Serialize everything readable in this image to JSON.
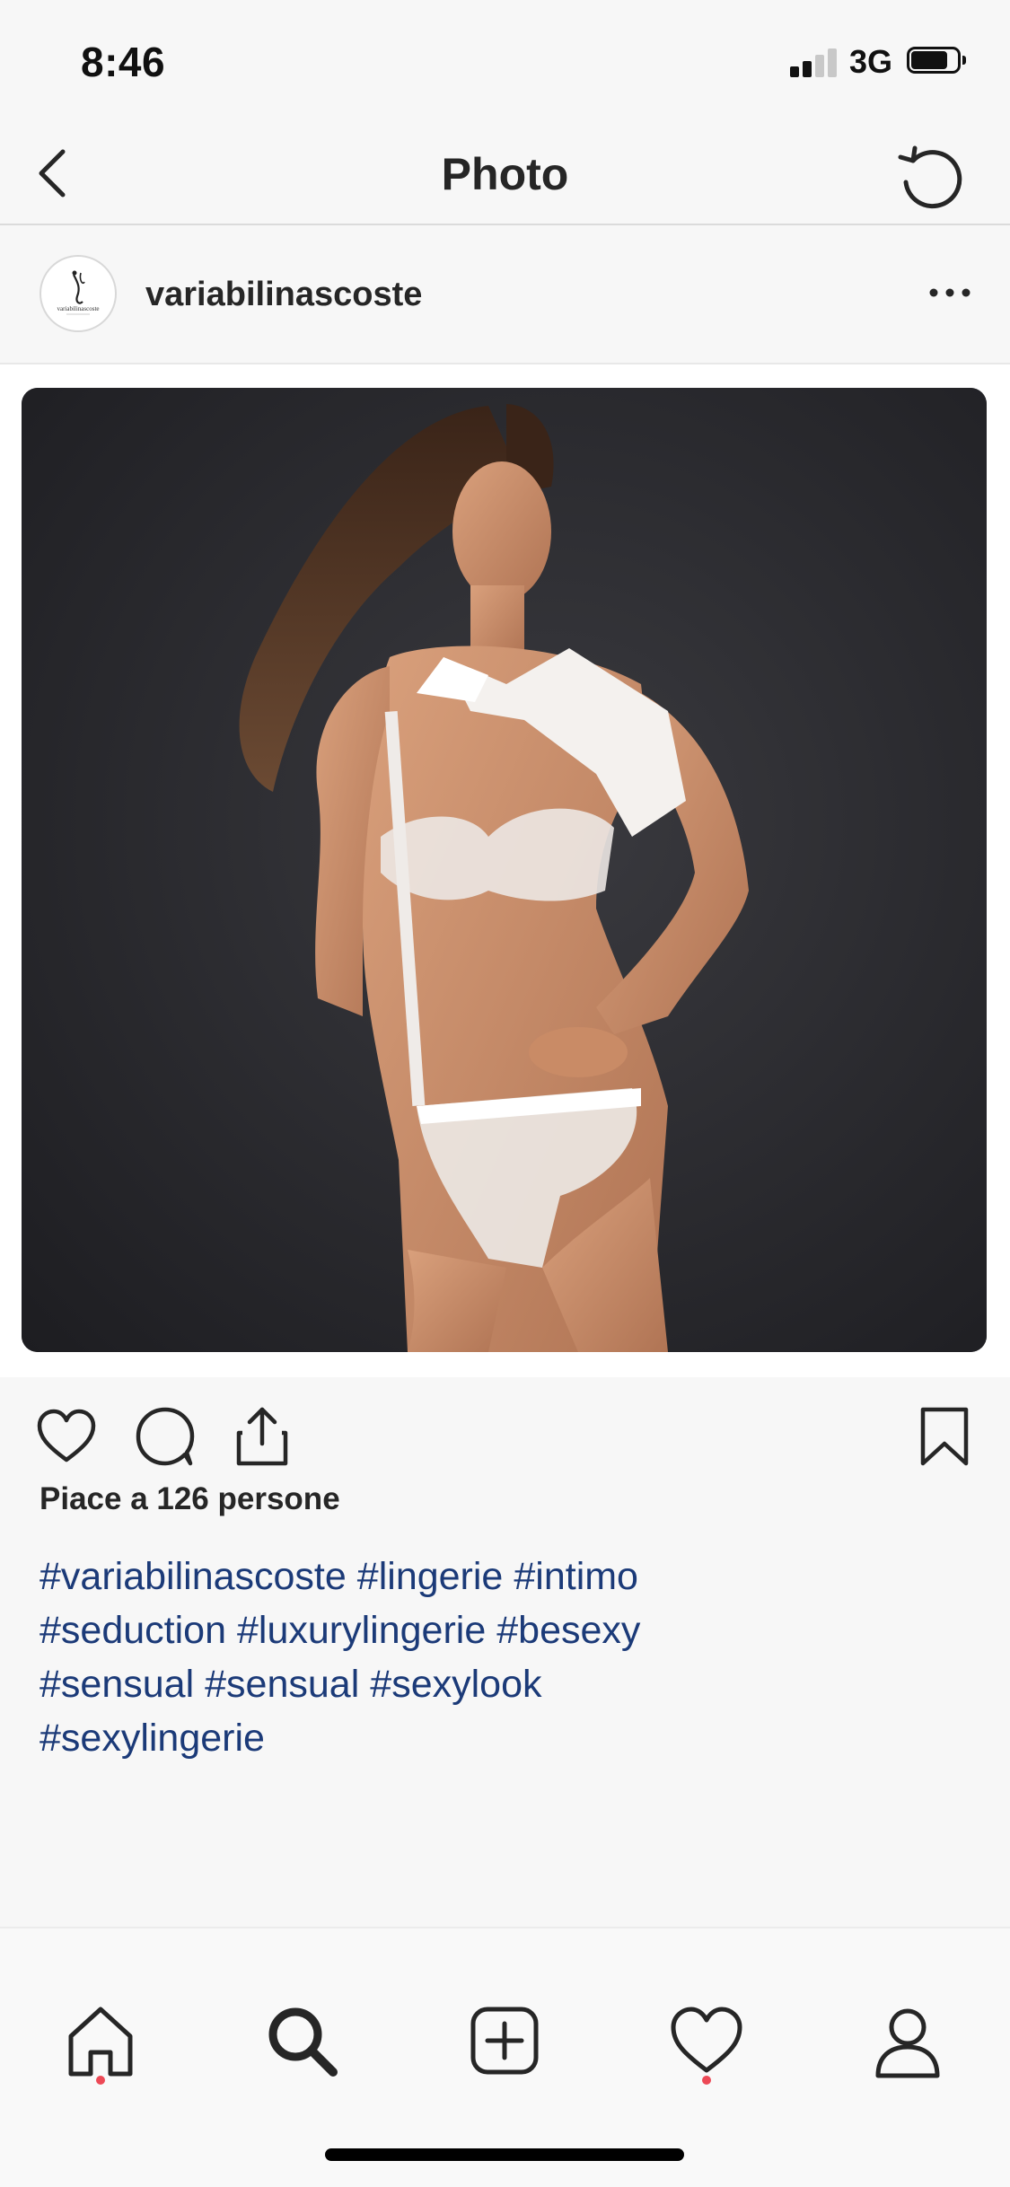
{
  "status_bar": {
    "time": "8:46",
    "network": "3G",
    "signal_bars_active": 2,
    "signal_bars_total": 4,
    "battery_level": 0.75
  },
  "nav": {
    "title": "Photo",
    "back_icon": "chevron-left-icon",
    "refresh_icon": "refresh-icon"
  },
  "post": {
    "username": "variabilinascoste",
    "avatar_logo_text": "variabilinascoste",
    "more_icon": "more-horizontal-icon",
    "photo_description": "",
    "likes_text": "Piace a 126 persone",
    "hashtags": [
      "#variabilinascoste",
      "#lingerie",
      "#intimo",
      "#seduction",
      "#luxurylingerie",
      "#besexy",
      "#sensual",
      "#sensual",
      "#sexylook",
      "#sexylingerie"
    ]
  },
  "actions": {
    "like_icon": "heart-icon",
    "comment_icon": "comment-icon",
    "share_icon": "share-icon",
    "save_icon": "bookmark-icon"
  },
  "tab_bar": {
    "items": [
      {
        "name": "home",
        "icon": "home-icon",
        "badge": true
      },
      {
        "name": "search",
        "icon": "search-icon",
        "badge": false,
        "active": true
      },
      {
        "name": "new-post",
        "icon": "add-post-icon",
        "badge": false
      },
      {
        "name": "activity",
        "icon": "heart-icon",
        "badge": true
      },
      {
        "name": "profile",
        "icon": "profile-icon",
        "badge": false
      }
    ],
    "badge_color": "#ed4956"
  },
  "colors": {
    "hashtag": "#1b3a78",
    "text": "#262626",
    "photo_background": "#242428"
  }
}
